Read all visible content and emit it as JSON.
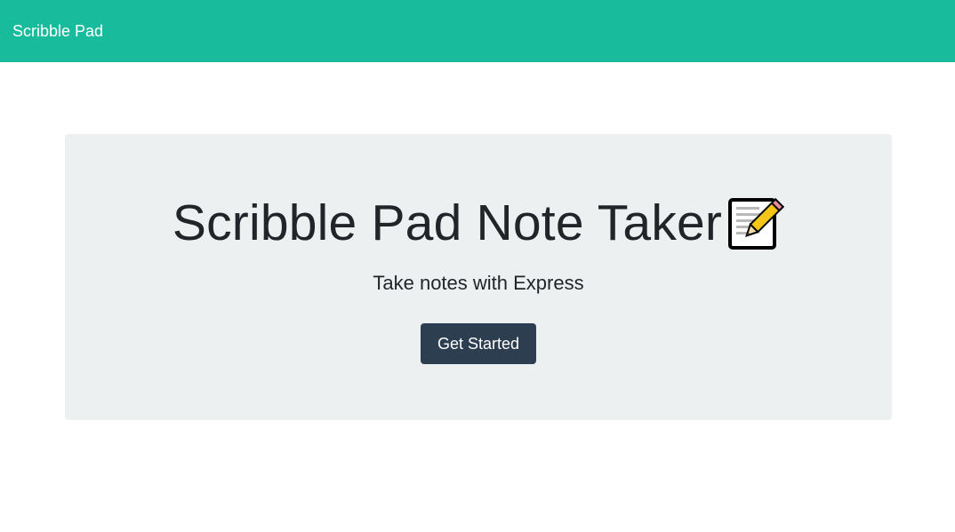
{
  "navbar": {
    "brand": "Scribble Pad",
    "background": "#18bc9c"
  },
  "hero": {
    "title": "Scribble Pad Note Taker",
    "title_icon": "memo-pencil-icon",
    "subtitle": "Take notes with Express",
    "cta_label": "Get Started",
    "background": "#ecf0f1"
  },
  "colors": {
    "accent": "#18bc9c",
    "button": "#2c3e50",
    "text": "#212529"
  }
}
